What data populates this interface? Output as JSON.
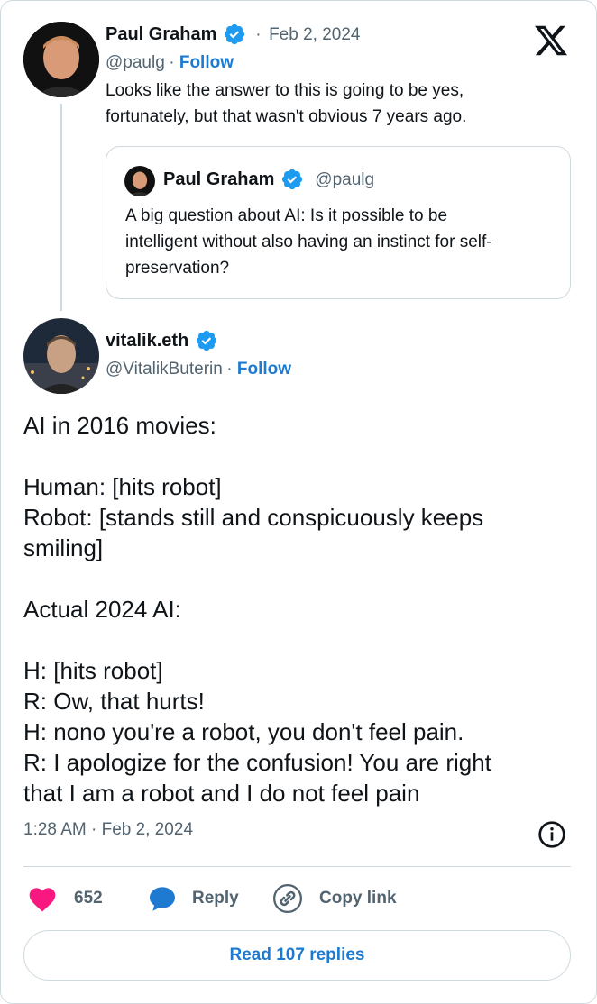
{
  "original_tweet": {
    "author_name": "Paul Graham",
    "date": "Feb 2, 2024",
    "handle": "@paulg",
    "follow_label": "Follow",
    "text_line1": "Looks like the answer to this is going to be yes,",
    "text_line2": "fortunately, but that wasn't obvious 7 years ago."
  },
  "quoted_tweet": {
    "author_name": "Paul Graham",
    "handle": "@paulg",
    "text_line1": "A big question about AI: Is it possible to be",
    "text_line2": "intelligent without also having an instinct for self-",
    "text_line3": "preservation?"
  },
  "main_tweet": {
    "author_name": "vitalik.eth",
    "handle": "@VitalikButerin",
    "follow_label": "Follow",
    "lines": {
      "l1": "AI in 2016 movies:",
      "l2": "Human: [hits robot]",
      "l3": "Robot: [stands still and conspicuously keeps",
      "l4": "smiling]",
      "l5": "Actual 2024 AI:",
      "l6": "H: [hits robot]",
      "l7": "R: Ow, that hurts!",
      "l8": "H: nono you're a robot, you don't feel pain.",
      "l9": "R: I apologize for the confusion! You are right",
      "l10": "that I am a robot and I do not feel pain"
    },
    "timestamp": "1:28 AM · Feb 2, 2024"
  },
  "actions": {
    "like_count": "652",
    "reply_label": "Reply",
    "copy_link_label": "Copy link",
    "read_replies_label": "Read 107 replies"
  },
  "icons": {
    "logo": "x-logo-icon",
    "verified": "verified-badge-icon",
    "like": "heart-icon",
    "reply": "speech-bubble-icon",
    "copy_link": "link-icon",
    "info": "info-icon"
  },
  "colors": {
    "accent": "#1d7ad0",
    "verified": "#1d9bf0",
    "like": "#f91880",
    "text": "#0f1419",
    "muted": "#536471",
    "border": "#cfd9de"
  }
}
